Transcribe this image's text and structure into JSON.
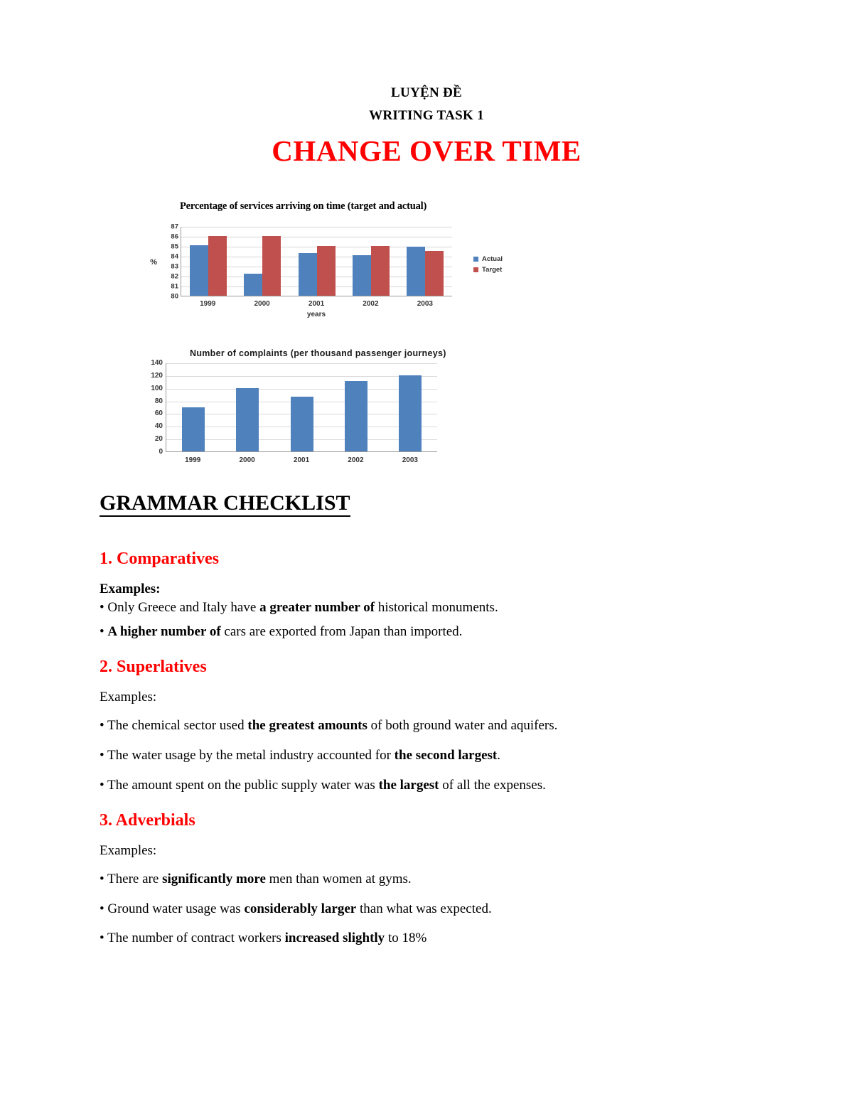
{
  "header": {
    "line1": "LUYỆN ĐỀ",
    "line2": "WRITING TASK 1",
    "title": "CHANGE OVER TIME",
    "title_color": "#ff0000"
  },
  "chart_data": [
    {
      "type": "bar",
      "title": "Percentage of services arriving on time (target and actual)",
      "xlabel": "years",
      "ylabel": "%",
      "categories": [
        "1999",
        "2000",
        "2001",
        "2002",
        "2003"
      ],
      "series": [
        {
          "name": "Actual",
          "color": "#4f81bd",
          "values": [
            85.1,
            82.25,
            84.3,
            84.1,
            84.9
          ]
        },
        {
          "name": "Target",
          "color": "#c0504d",
          "values": [
            86,
            86,
            85,
            85,
            84.5
          ]
        }
      ],
      "ylim": [
        80,
        87
      ],
      "yticks": [
        87,
        86,
        85,
        84,
        83,
        82,
        81,
        80
      ],
      "grid": true,
      "legend_position": "right"
    },
    {
      "type": "bar",
      "title": "Number of complaints (per thousand passenger journeys)",
      "xlabel": "",
      "ylabel": "",
      "categories": [
        "1999",
        "2000",
        "2001",
        "2002",
        "2003"
      ],
      "values": [
        70,
        100,
        86,
        111,
        120
      ],
      "color": "#4f81bd",
      "ylim": [
        0,
        140
      ],
      "yticks": [
        140,
        120,
        100,
        80,
        60,
        40,
        20,
        0
      ],
      "grid": true,
      "legend_position": "none"
    }
  ],
  "checklist": {
    "title": "GRAMMAR CHECKLIST",
    "sections": [
      {
        "heading": "1. Comparatives",
        "examples_label": "Examples:",
        "examples_label_bold": true,
        "items": [
          {
            "pre": "• Only Greece and Italy have ",
            "bold": "a greater number of",
            "post": " historical monuments."
          },
          {
            "pre": "• ",
            "bold": "A higher number of",
            "post": " cars are exported from Japan than imported."
          }
        ]
      },
      {
        "heading": "2. Superlatives",
        "examples_label": "Examples:",
        "examples_label_bold": false,
        "items": [
          {
            "pre": "• The chemical sector used ",
            "bold": "the greatest amounts",
            "post": " of both ground water and aquifers."
          },
          {
            "pre": "• The water usage by the metal industry accounted for ",
            "bold": "the second largest",
            "post": "."
          },
          {
            "pre": "• The amount spent on the public supply water was ",
            "bold": "the largest",
            "post": " of all the expenses."
          }
        ]
      },
      {
        "heading": "3. Adverbials",
        "examples_label": "Examples:",
        "examples_label_bold": false,
        "items": [
          {
            "pre": "• There are ",
            "bold": "significantly more",
            "post": " men than women at gyms."
          },
          {
            "pre": "• Ground water usage was ",
            "bold": "considerably larger",
            "post": " than what was expected."
          },
          {
            "pre": "• The number of contract workers ",
            "bold": "increased slightly",
            "post": " to 18%"
          }
        ]
      }
    ]
  }
}
